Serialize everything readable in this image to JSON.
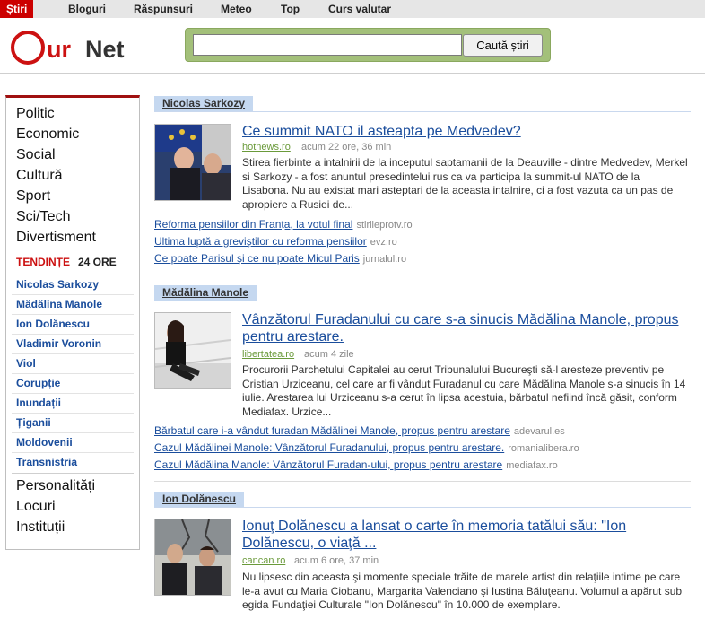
{
  "topnav": {
    "tabs": [
      {
        "label": "Știri"
      },
      {
        "label": "Bloguri"
      },
      {
        "label": "Răspunsuri"
      },
      {
        "label": "Meteo"
      },
      {
        "label": "Top"
      },
      {
        "label": "Curs valutar"
      }
    ]
  },
  "header": {
    "logo_ur": "ur",
    "logo_net": "Net",
    "search_button": "Caută știri",
    "search_value": ""
  },
  "sidebar": {
    "categories": [
      "Politic",
      "Economic",
      "Social",
      "Cultură",
      "Sport",
      "Sci/Tech",
      "Divertisment"
    ],
    "trends_title": "TENDINȚE",
    "trends_period": "24 ORE",
    "trends": [
      "Nicolas Sarkozy",
      "Mădălina Manole",
      "Ion Dolănescu",
      "Vladimir Voronin",
      "Viol",
      "Corupție",
      "Inundații",
      "Țiganii",
      "Moldovenii",
      "Transnistria"
    ],
    "extras": [
      "Personalități",
      "Locuri",
      "Instituții"
    ]
  },
  "sections": [
    {
      "title": "Nicolas Sarkozy",
      "headline": "Ce summit NATO il asteapta pe Medvedev?",
      "source": "hotnews.ro",
      "time": "acum 22 ore, 36 min",
      "summary": "Stirea fierbinte a intalnirii de la inceputul saptamanii de la Deauville - dintre Medvedev, Merkel si Sarkozy - a fost anuntul presedintelui rus ca va participa la summit-ul NATO de la Lisabona. Nu au existat mari asteptari de la aceasta intalnire, ci a fost vazuta ca un pas de apropiere a Rusiei de...",
      "related": [
        {
          "title": "Reforma pensiilor din Franța, la votul final",
          "source": "stirileprotv.ro"
        },
        {
          "title": "Ultima luptă a greviștilor cu reforma pensiilor",
          "source": "evz.ro"
        },
        {
          "title": "Ce poate Parisul și ce nu poate Micul Paris",
          "source": "jurnalul.ro"
        }
      ]
    },
    {
      "title": "Mădălina Manole",
      "headline": "Vânzătorul Furadanului cu care s-a sinucis Mădălina Manole, propus pentru arestare.",
      "source": "libertatea.ro",
      "time": "acum 4 zile",
      "summary": "Procurorii Parchetului Capitalei au cerut Tribunalului Bucureşti să-l aresteze preventiv pe Cristian Urziceanu, cel care ar fi vândut Furadanul cu care  Mădălina Manole s-a sinucis în 14 iulie. Arestarea lui Urziceanu s-a cerut în lipsa acestuia, bărbatul nefiind încă găsit, conform Mediafax. Urzice...",
      "related": [
        {
          "title": "Bărbatul care i-a vândut furadan Mădălinei Manole, propus pentru arestare",
          "source": "adevarul.es"
        },
        {
          "title": "Cazul Mădălinei Manole: Vânzătorul Furadanului, propus pentru arestare.",
          "source": "romanialibera.ro"
        },
        {
          "title": "Cazul Mădălina Manole: Vânzătorul Furadan-ului, propus pentru arestare",
          "source": "mediafax.ro"
        }
      ]
    },
    {
      "title": "Ion Dolănescu",
      "headline": "Ionuţ Dolănescu a lansat o carte în memoria tatălui său: \"Ion Dolănescu, o viaţă ...",
      "source": "cancan.ro",
      "time": "acum 6 ore, 37 min",
      "summary": "Nu lipsesc din aceasta şi momente speciale trăite de marele artist din relaţiile intime pe care le-a avut cu Maria Ciobanu, Margarita Valenciano şi Iustina Băluţeanu. Volumul a apărut sub egida Fundaţiei Culturale \"Ion Dolănescu\" în 10.000 de exemplare.",
      "related": []
    }
  ]
}
